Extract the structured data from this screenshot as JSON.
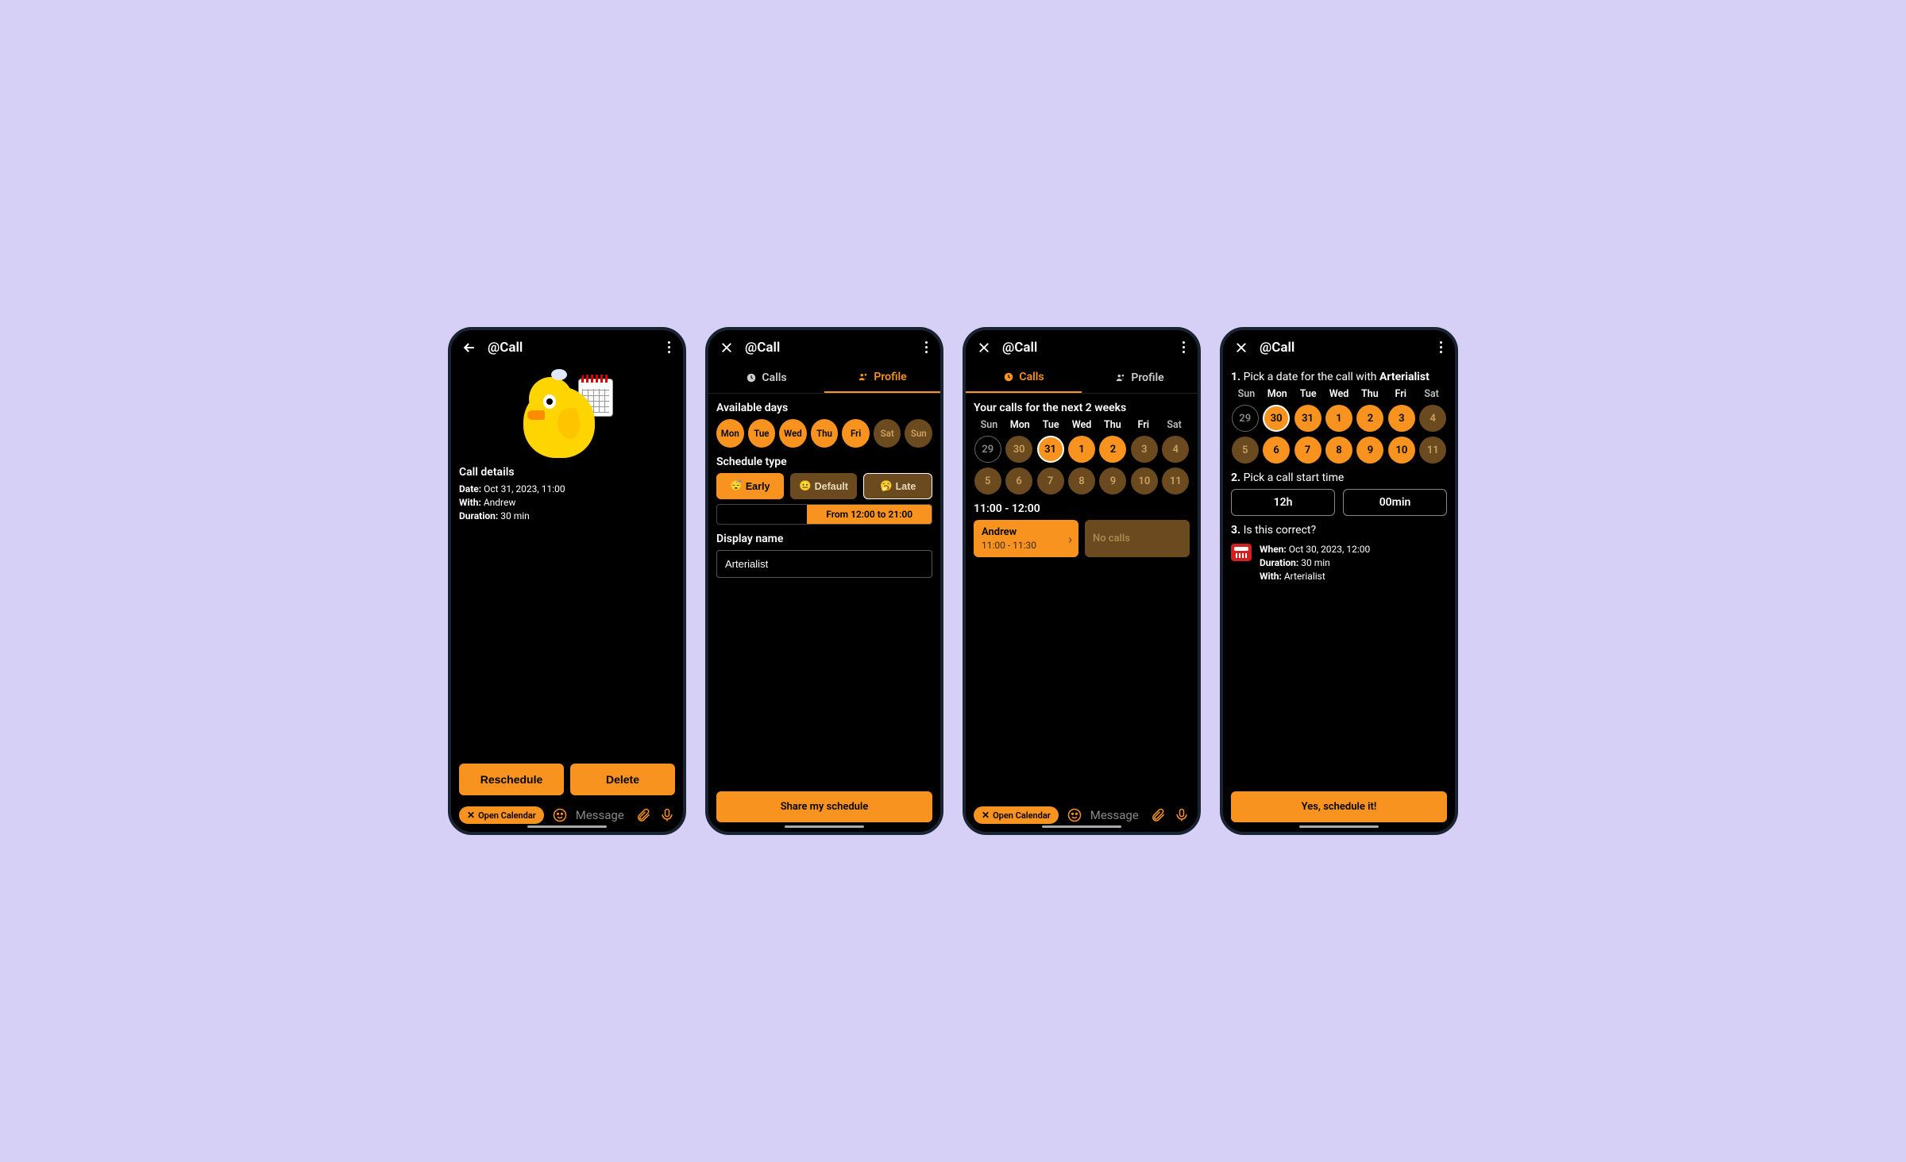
{
  "app_title": "@Call",
  "screen1": {
    "section": "Call details",
    "date_label": "Date:",
    "date_value": "Oct 31, 2023, 11:00",
    "with_label": "With:",
    "with_value": "Andrew",
    "duration_label": "Duration:",
    "duration_value": "30 min",
    "reschedule": "Reschedule",
    "delete": "Delete",
    "open_calendar": "Open Calendar",
    "message_placeholder": "Message"
  },
  "screen2": {
    "tab_calls": "Calls",
    "tab_profile": "Profile",
    "available_days": "Available days",
    "days": [
      "Mon",
      "Tue",
      "Wed",
      "Thu",
      "Fri",
      "Sat",
      "Sun"
    ],
    "schedule_type": "Schedule type",
    "early": "Early",
    "default": "Default",
    "late": "Late",
    "bar_text": "From 12:00 to 21:00",
    "display_name": "Display name",
    "display_name_value": "Arterialist",
    "share": "Share my schedule"
  },
  "screen3": {
    "tab_calls": "Calls",
    "tab_profile": "Profile",
    "title": "Your calls for the next 2 weeks",
    "weekdays": [
      "Sun",
      "Mon",
      "Tue",
      "Wed",
      "Thu",
      "Fri",
      "Sat"
    ],
    "row1": [
      "29",
      "30",
      "31",
      "1",
      "2",
      "3",
      "4"
    ],
    "row2": [
      "5",
      "6",
      "7",
      "8",
      "9",
      "10",
      "11"
    ],
    "time_slot": "11:00 - 12:00",
    "card_name": "Andrew",
    "card_time": "11:00 - 11:30",
    "no_calls": "No calls",
    "open_calendar": "Open Calendar",
    "message_placeholder": "Message"
  },
  "screen4": {
    "step1_pre": "1. ",
    "step1_text": "Pick a date for the call with ",
    "step1_name": "Arterialist",
    "weekdays": [
      "Sun",
      "Mon",
      "Tue",
      "Wed",
      "Thu",
      "Fri",
      "Sat"
    ],
    "row1": [
      "29",
      "30",
      "31",
      "1",
      "2",
      "3",
      "4"
    ],
    "row2": [
      "5",
      "6",
      "7",
      "8",
      "9",
      "10",
      "11"
    ],
    "step2_pre": "2. ",
    "step2_text": "Pick a call start time",
    "hour": "12h",
    "min": "00min",
    "step3_pre": "3. ",
    "step3_text": "Is this correct?",
    "when_label": "When:",
    "when_value": "Oct 30, 2023, 12:00",
    "duration_label": "Duration:",
    "duration_value": "30 min",
    "with_label": "With:",
    "with_value": "Arterialist",
    "confirm": "Yes, schedule it!"
  }
}
